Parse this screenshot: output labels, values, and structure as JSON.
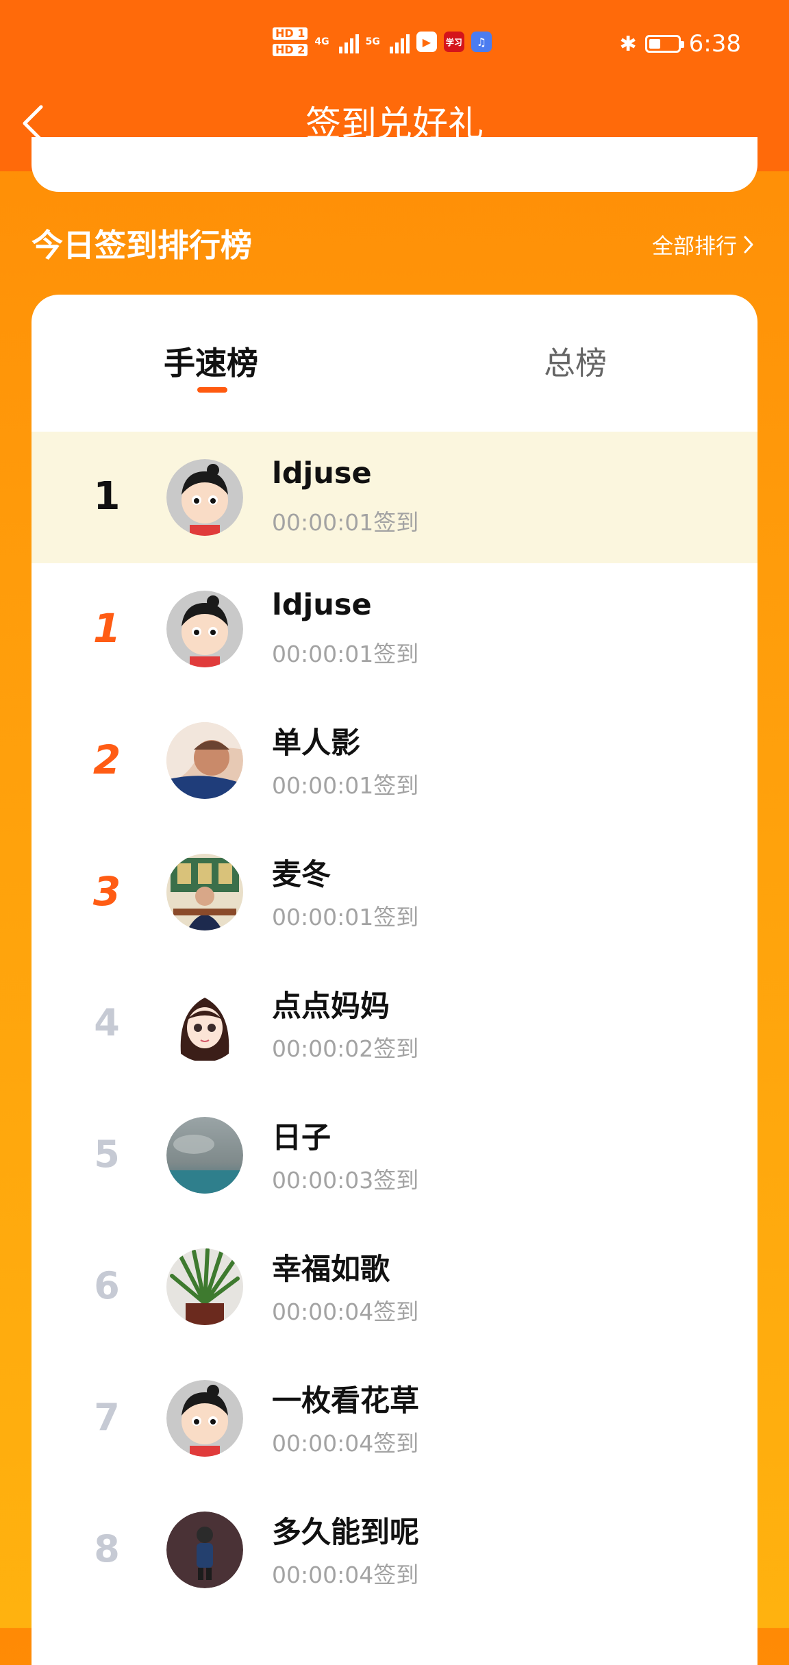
{
  "status_bar": {
    "hd1": "HD 1",
    "hd2": "HD 2",
    "net1": "4G",
    "net2": "5G",
    "app3": "学习",
    "time": "6:38",
    "battery_level": 0.4
  },
  "header": {
    "title": "签到兑好礼"
  },
  "section": {
    "title": "今日签到排行榜",
    "all_rank": "全部排行"
  },
  "tabs": {
    "speed": "手速榜",
    "total": "总榜"
  },
  "my_row": {
    "rank": "1",
    "name": "ldjuse",
    "time": "00:00:01签到"
  },
  "rows": [
    {
      "rank": "1",
      "name": "ldjuse",
      "time": "00:00:01签到"
    },
    {
      "rank": "2",
      "name": "单人影",
      "time": "00:00:01签到"
    },
    {
      "rank": "3",
      "name": "麦冬",
      "time": "00:00:01签到"
    },
    {
      "rank": "4",
      "name": "点点妈妈",
      "time": "00:00:02签到"
    },
    {
      "rank": "5",
      "name": "日子",
      "time": "00:00:03签到"
    },
    {
      "rank": "6",
      "name": "幸福如歌",
      "time": "00:00:04签到"
    },
    {
      "rank": "7",
      "name": "一枚看花草",
      "time": "00:00:04签到"
    },
    {
      "rank": "8",
      "name": "多久能到呢",
      "time": "00:00:04签到"
    }
  ],
  "colors": {
    "header": "#ff6a0a",
    "accent": "#ff5c14",
    "highlight_row": "#fbf6de"
  }
}
